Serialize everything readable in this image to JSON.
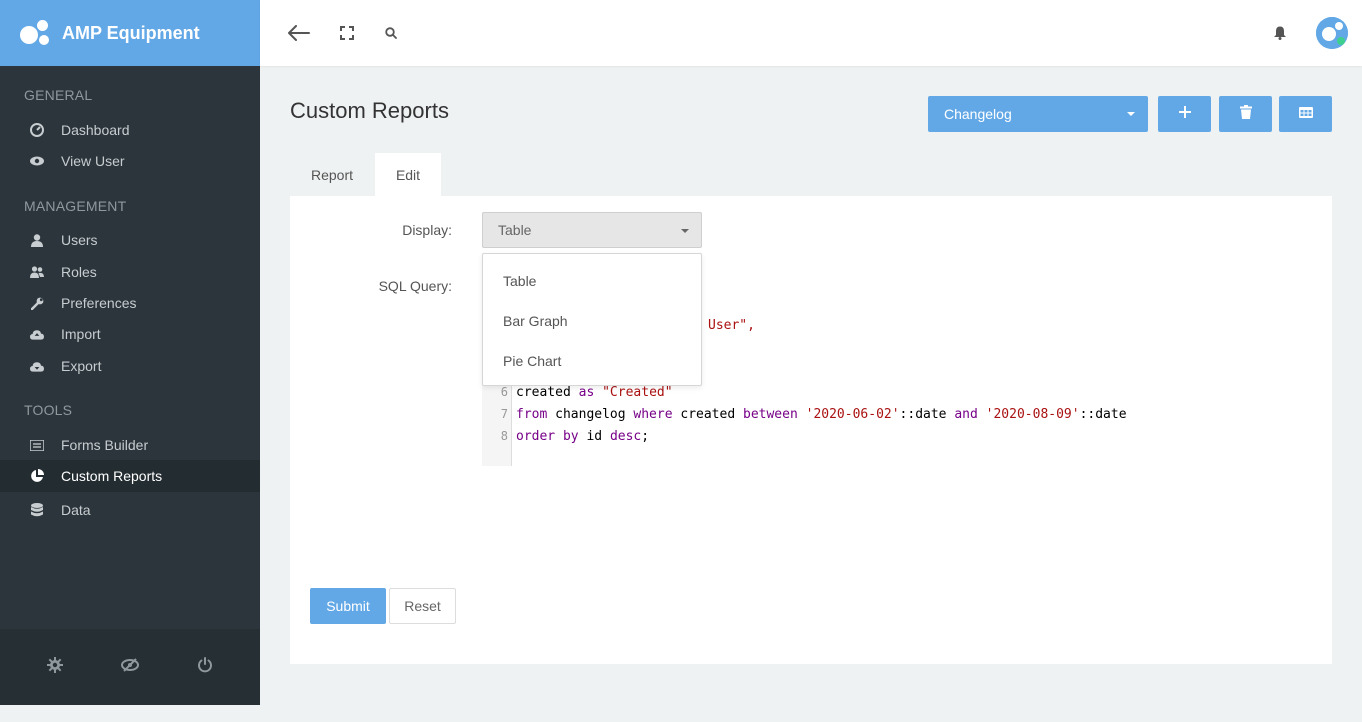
{
  "brand": {
    "name": "AMP Equipment"
  },
  "sidebar": {
    "sections": [
      {
        "heading": "GENERAL"
      },
      {
        "heading": "MANAGEMENT"
      },
      {
        "heading": "TOOLS"
      }
    ],
    "items": [
      {
        "label": "Dashboard",
        "icon": "dashboard-icon"
      },
      {
        "label": "View User",
        "icon": "eye-icon"
      },
      {
        "label": "Users",
        "icon": "user-icon"
      },
      {
        "label": "Roles",
        "icon": "users-icon"
      },
      {
        "label": "Preferences",
        "icon": "wrench-icon"
      },
      {
        "label": "Import",
        "icon": "cloud-upload-icon"
      },
      {
        "label": "Export",
        "icon": "cloud-download-icon"
      },
      {
        "label": "Forms Builder",
        "icon": "list-icon"
      },
      {
        "label": "Custom Reports",
        "icon": "pie-chart-icon",
        "active": true
      },
      {
        "label": "Data",
        "icon": "database-icon"
      }
    ],
    "footer_icons": [
      "gear-icon",
      "eye-slash-icon",
      "power-icon"
    ]
  },
  "topbar": {
    "icons": [
      "back-arrow-icon",
      "fullscreen-icon",
      "search-icon",
      "bell-icon"
    ]
  },
  "page": {
    "title": "Custom Reports",
    "report_selector": {
      "value": "Changelog"
    },
    "header_buttons": [
      "add-icon",
      "trash-icon",
      "table-icon"
    ],
    "tabs": [
      {
        "label": "Report"
      },
      {
        "label": "Edit",
        "active": true
      }
    ]
  },
  "form": {
    "display_label": "Display:",
    "display_value": "Table",
    "display_options": [
      "Table",
      "Bar Graph",
      "Pie Chart"
    ],
    "sql_label": "SQL Query:",
    "visible_fragment": "User\",",
    "code_lines": [
      {
        "number": "6",
        "text": "created as \"Created\""
      },
      {
        "number": "7",
        "text": "from changelog where created between '2020-06-02'::date and '2020-08-09'::date"
      },
      {
        "number": "8",
        "text": "order by id desc;"
      }
    ],
    "submit_label": "Submit",
    "reset_label": "Reset"
  },
  "colors": {
    "accent": "#63a8e6",
    "sidebar": "#2b353b",
    "keyword": "#770088",
    "string": "#aa1111"
  }
}
